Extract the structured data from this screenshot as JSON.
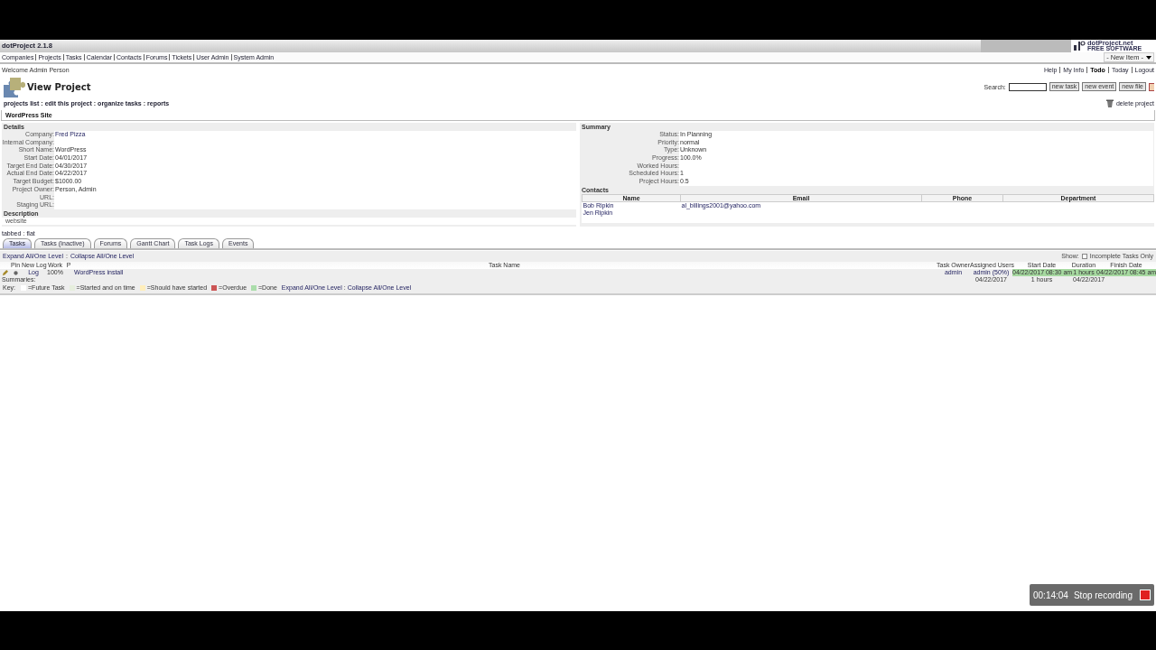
{
  "app": {
    "title": "dotProject 2.1.8",
    "logo_name": "dotProject.net",
    "logo_tagline": "FREE SOFTWARE"
  },
  "menu": [
    "Companies",
    "Projects",
    "Tasks",
    "Calendar",
    "Contacts",
    "Forums",
    "Tickets",
    "User Admin",
    "System Admin"
  ],
  "new_item": "- New Item -",
  "welcome": "Welcome Admin Person",
  "user_links": [
    {
      "label": "Help",
      "selected": false
    },
    {
      "label": "My Info",
      "selected": false
    },
    {
      "label": "Todo",
      "selected": true
    },
    {
      "label": "Today",
      "selected": false
    },
    {
      "label": "Logout",
      "selected": false
    }
  ],
  "page": {
    "title": "View Project",
    "search_label": "Search:",
    "buttons": [
      "new task",
      "new event",
      "new file"
    ],
    "actions": [
      "projects list",
      "edit this project",
      "organize tasks",
      "reports"
    ],
    "delete": "delete project"
  },
  "project": {
    "name": "WordPress Site",
    "details": {
      "heading": "Details",
      "fields": [
        {
          "label": "Company:",
          "value": "Fred Pizza",
          "link": true
        },
        {
          "label": "Internal Company:"
        },
        {
          "label": "Short Name:",
          "value": "WordPress",
          "link": false
        },
        {
          "label": "Start Date:",
          "value": "04/01/2017",
          "link": false
        },
        {
          "label": "Target End Date:",
          "value": "04/30/2017",
          "link": false
        },
        {
          "label": "Actual End Date:",
          "value": "04/22/2017",
          "link": false
        },
        {
          "label": "Target Budget:",
          "value": "$1000.00",
          "link": false
        },
        {
          "label": "Project Owner:",
          "value": "Person, Admin",
          "link": false
        },
        {
          "label": "URL:"
        },
        {
          "label": "Staging URL:"
        }
      ]
    },
    "description": {
      "heading": "Description",
      "text": "website"
    },
    "summary": {
      "heading": "Summary",
      "fields": [
        {
          "label": "Status:",
          "value": "In Planning"
        },
        {
          "label": "Priority:",
          "value": "normal"
        },
        {
          "label": "Type:",
          "value": "Unknown"
        },
        {
          "label": "Progress:",
          "value": "100.0%"
        },
        {
          "label": "Worked Hours:"
        },
        {
          "label": "Scheduled Hours:",
          "value": "1"
        },
        {
          "label": "Project Hours:",
          "value": "0.5"
        }
      ]
    },
    "contacts": {
      "heading": "Contacts",
      "columns": [
        "Name",
        "Email",
        "Phone",
        "Department"
      ],
      "rows": [
        {
          "name": "Bob Ripkin",
          "email": "al_billings2001@yahoo.com"
        },
        {
          "name": "Jen Ripkin"
        }
      ]
    }
  },
  "separator": ":",
  "views": [
    "tabbed",
    "flat"
  ],
  "tabs": [
    {
      "label": "Tasks",
      "selected": true
    },
    {
      "label": "Tasks (Inactive)",
      "selected": false
    },
    {
      "label": "Forums",
      "selected": false
    },
    {
      "label": "Gantt Chart",
      "selected": false
    },
    {
      "label": "Task Logs",
      "selected": false
    },
    {
      "label": "Events",
      "selected": false
    }
  ],
  "tasks": {
    "expand": "Expand All/One Level",
    "collapse": "Collapse All/One Level",
    "show_label": "Show:",
    "incomplete": {
      "label": "Incomplete Tasks Only",
      "checked": false
    },
    "columns": [
      "Pin",
      "New Log",
      "Work",
      "P",
      "Task Name",
      "Task Owner",
      "Assigned Users",
      "Start Date",
      "Duration",
      "Finish Date"
    ],
    "rows": [
      {
        "log": "Log",
        "work": "100%",
        "name": "WordPress install",
        "owner": "admin",
        "assigned": "admin (50%)",
        "start": "04/22/2017 08:30 am",
        "duration": "1 hours",
        "finish": "04/22/2017 08:45 am",
        "color": "#a6d9a0"
      }
    ],
    "summaries": {
      "label": "Summaries:",
      "start": "04/22/2017",
      "duration": "1 hours",
      "finish": "04/22/2017"
    },
    "key": {
      "label": "Key:",
      "items": [
        {
          "label": "=Future Task",
          "color": "#ffffff"
        },
        {
          "label": "=Started and on time",
          "color": "#e6eedd"
        },
        {
          "label": "=Should have started",
          "color": "#ffeebb"
        },
        {
          "label": "=Overdue",
          "color": "#cc5555"
        },
        {
          "label": "=Done",
          "color": "#aaddaa"
        }
      ],
      "expand": "Expand All/One Level",
      "collapse": "Collapse All/One Level"
    }
  },
  "recorder": {
    "time": "00:14:04",
    "label": "Stop recording"
  }
}
